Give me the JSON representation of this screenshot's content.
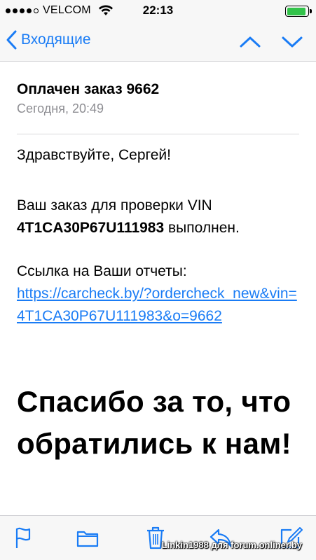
{
  "status_bar": {
    "carrier": "VELCOM",
    "time": "22:13",
    "signal_filled": 4,
    "signal_total": 5,
    "battery_level": 0.9,
    "battery_color": "#32c34a"
  },
  "nav": {
    "back_label": "Входящие",
    "accent_color": "#1a7cf5",
    "icons": [
      "chevron-left-icon",
      "chevron-up-icon",
      "chevron-down-icon"
    ]
  },
  "message": {
    "subject": "Оплачен заказ 9662",
    "date": "Сегодня, 20:49",
    "greeting": "Здравствуйте, Сергей!",
    "order_line1": "Ваш заказ для проверки VIN",
    "vin": "4T1CA30P67U111983",
    "order_done": " выполнен.",
    "links_label": "Ссылка на Ваши отчеты:",
    "report_link": "https://carcheck.by/?ordercheck_new&vin=4T1CA30P67U111983&o=9662",
    "thanks": "Спасибо за то, что обратились к нам!"
  },
  "toolbar": {
    "icons": [
      "flag-icon",
      "folder-icon",
      "trash-icon",
      "reply-icon",
      "compose-icon"
    ]
  },
  "watermark": "Linkin1988 для forum.onliner.by"
}
